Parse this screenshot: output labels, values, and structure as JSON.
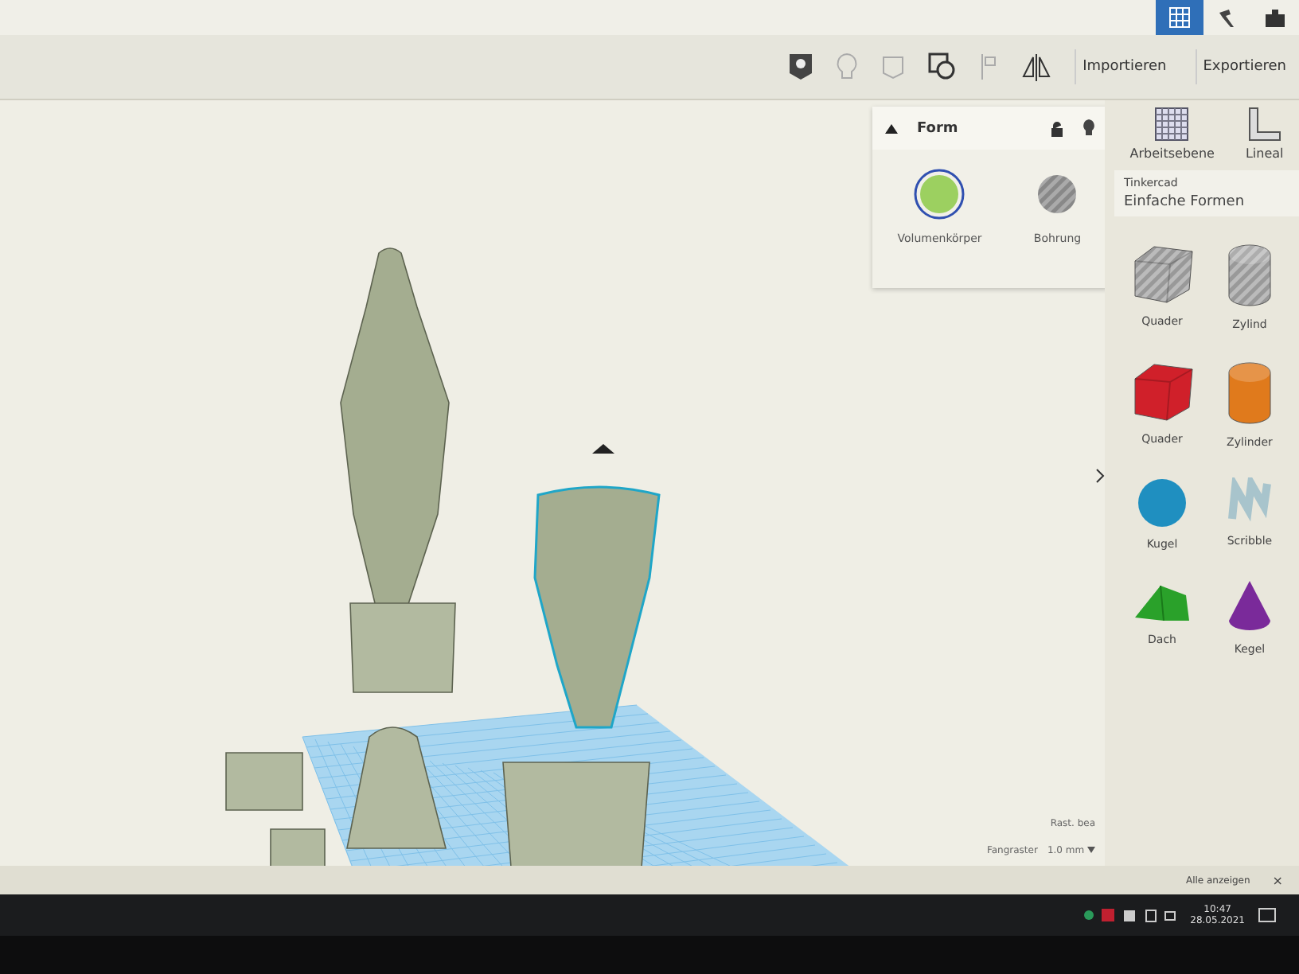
{
  "toolbar": {
    "buttons": [
      "Importieren",
      "Exportieren"
    ]
  },
  "form_panel": {
    "title": "Form",
    "options": [
      {
        "label": "Volumenkörper",
        "kind": "solid",
        "selected": true
      },
      {
        "label": "Bohrung",
        "kind": "hole",
        "selected": false
      }
    ]
  },
  "sidebar": {
    "tools": [
      {
        "label": "Arbeitsebene",
        "kind": "grid"
      },
      {
        "label": "Lineal",
        "kind": "ruler"
      }
    ],
    "library": {
      "source": "Tinkercad",
      "name": "Einfache Formen"
    },
    "shapes": [
      {
        "label": "Quader",
        "kind": "cube-striped"
      },
      {
        "label": "Zylind",
        "kind": "cylinder-striped"
      },
      {
        "label": "Quader",
        "kind": "cube"
      },
      {
        "label": "Zylinder",
        "kind": "cylinder"
      },
      {
        "label": "Kugel",
        "kind": "sphere"
      },
      {
        "label": "Scribble",
        "kind": "scribble"
      },
      {
        "label": "Dach",
        "kind": "roof"
      },
      {
        "label": "Kegel",
        "kind": "cone"
      }
    ]
  },
  "workspace": {
    "grid_edit": "Rast. bea",
    "snap_label": "Fangraster",
    "snap_value": "1.0 mm"
  },
  "notification": {
    "action": "Alle anzeigen",
    "close": "×"
  },
  "taskbar": {
    "time": "10:47",
    "date": "28.05.2021"
  }
}
